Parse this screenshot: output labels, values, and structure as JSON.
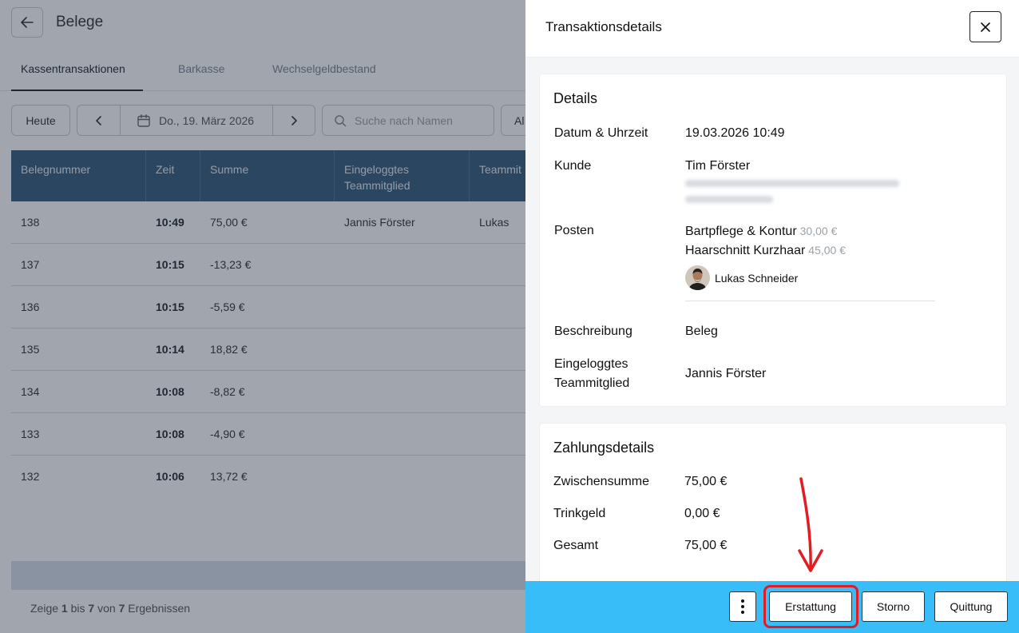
{
  "page": {
    "title": "Belege",
    "tabs": [
      {
        "label": "Kassentransaktionen"
      },
      {
        "label": "Barkasse"
      },
      {
        "label": "Wechselgeldbestand"
      }
    ],
    "today_label": "Heute",
    "date_label": "Do., 19. März 2026",
    "search_placeholder": "Suche nach Namen",
    "filter_label": "Al",
    "table": {
      "headers": [
        "Belegnummer",
        "Zeit",
        "Summe",
        "Eingeloggtes Teammitglied",
        "Teammit"
      ],
      "rows": [
        {
          "nr": "138",
          "time": "10:49",
          "sum": "75,00 €",
          "member": "Jannis Förster",
          "team": "Lukas"
        },
        {
          "nr": "137",
          "time": "10:15",
          "sum": "-13,23 €",
          "member": "",
          "team": ""
        },
        {
          "nr": "136",
          "time": "10:15",
          "sum": "-5,59 €",
          "member": "",
          "team": ""
        },
        {
          "nr": "135",
          "time": "10:14",
          "sum": "18,82 €",
          "member": "",
          "team": ""
        },
        {
          "nr": "134",
          "time": "10:08",
          "sum": "-8,82 €",
          "member": "",
          "team": ""
        },
        {
          "nr": "133",
          "time": "10:08",
          "sum": "-4,90 €",
          "member": "",
          "team": ""
        },
        {
          "nr": "132",
          "time": "10:06",
          "sum": "13,72 €",
          "member": "",
          "team": ""
        }
      ]
    },
    "pager": {
      "prefix": "Zeige ",
      "from": "1",
      "mid1": " bis ",
      "to": "7",
      "mid2": " von ",
      "total": "7",
      "suffix": " Ergebnissen"
    }
  },
  "panel": {
    "title": "Transaktionsdetails",
    "details": {
      "title": "Details",
      "datetime_label": "Datum & Uhrzeit",
      "datetime_value": "19.03.2026 10:49",
      "customer_label": "Kunde",
      "customer_name": "Tim Förster",
      "items_label": "Posten",
      "items": [
        {
          "name": "Bartpflege & Kontur",
          "price": "30,00 €"
        },
        {
          "name": "Haarschnitt Kurzhaar",
          "price": "45,00 €"
        }
      ],
      "staff_name": "Lukas Schneider",
      "description_label": "Beschreibung",
      "description_value": "Beleg",
      "member_label_1": "Eingeloggtes",
      "member_label_2": "Teammitglied",
      "member_value": "Jannis Förster"
    },
    "payment": {
      "title": "Zahlungsdetails",
      "subtotal_label": "Zwischensumme",
      "subtotal_value": "75,00 €",
      "tip_label": "Trinkgeld",
      "tip_value": "0,00 €",
      "total_label": "Gesamt",
      "total_value": "75,00 €"
    },
    "footer": {
      "refund_label": "Erstattung",
      "cancel_label": "Storno",
      "receipt_label": "Quittung"
    }
  },
  "colors": {
    "table_header": "#335c7d",
    "footer_bar": "#38bdf8",
    "highlight": "#e11d22"
  },
  "icons": [
    "arrow-left-icon",
    "chevron-left-icon",
    "calendar-icon",
    "chevron-right-icon",
    "search-icon",
    "close-icon",
    "more-vertical-icon",
    "annotation-arrow-icon"
  ]
}
